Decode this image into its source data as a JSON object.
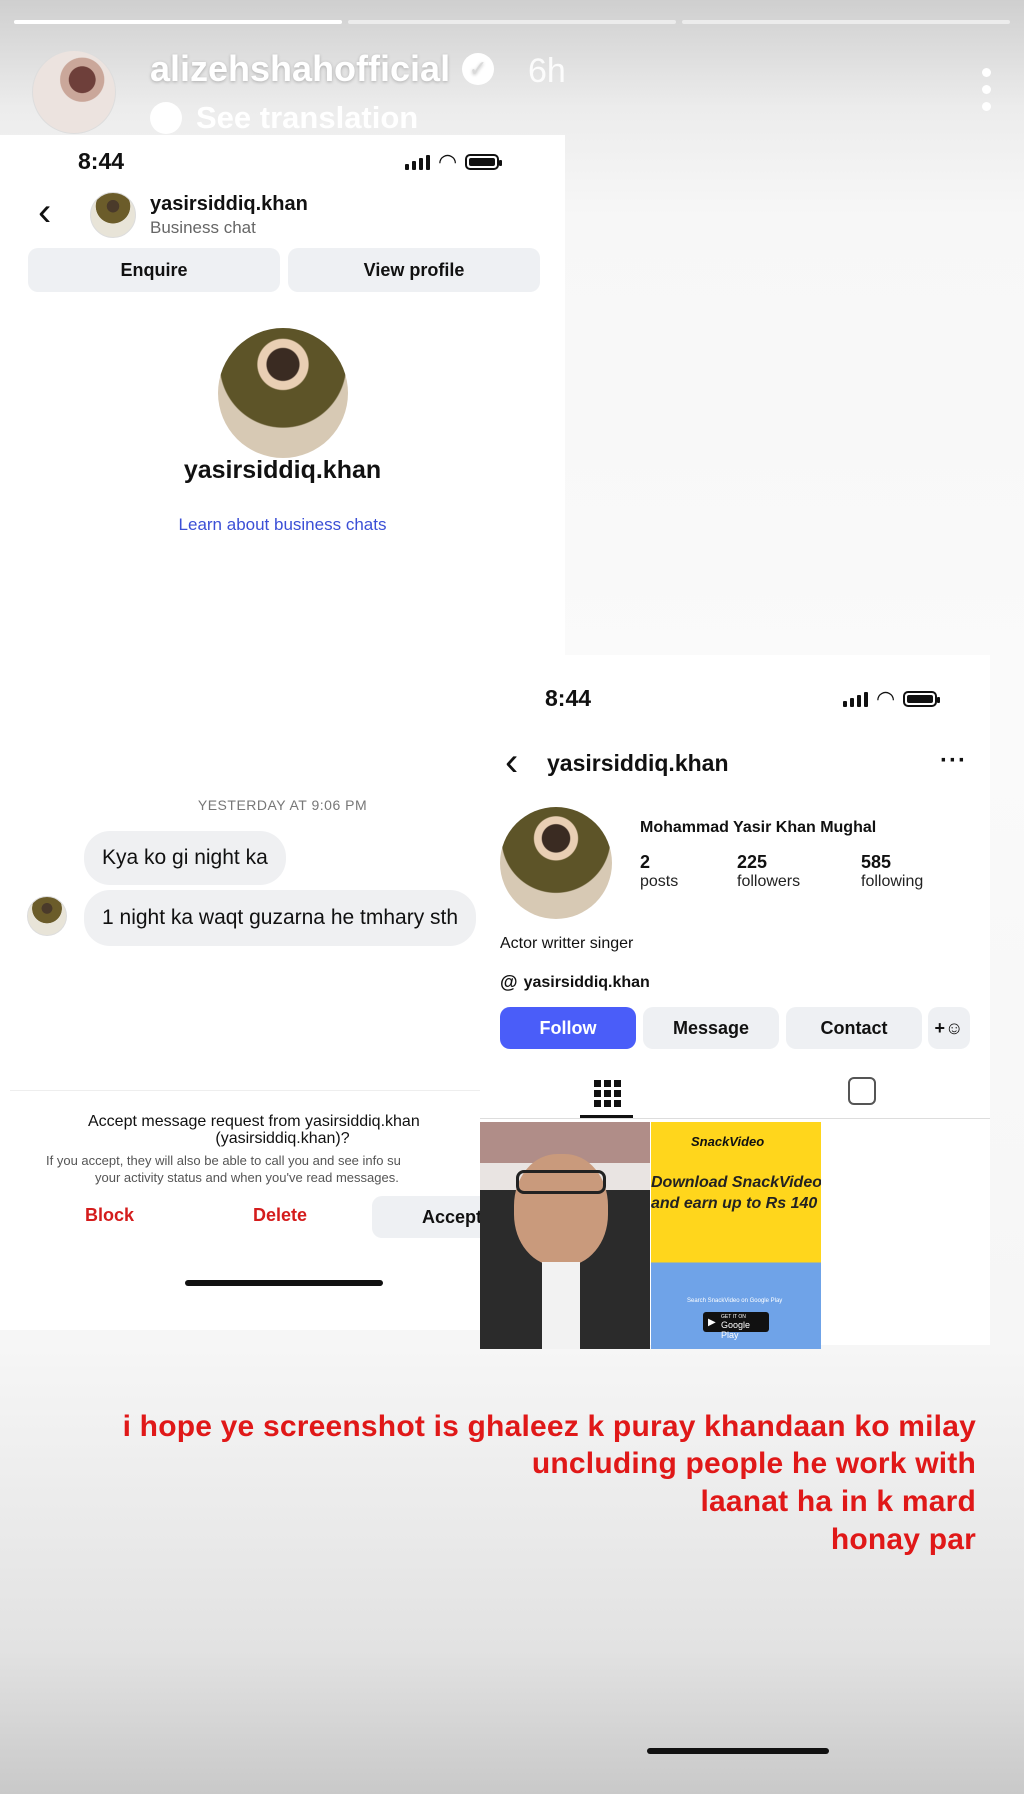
{
  "story": {
    "username": "alizehshahofficial",
    "time_ago": "6h",
    "see_translation": "See translation",
    "progress": [
      1.0,
      0.0,
      0.0
    ]
  },
  "left_screen": {
    "status_time": "8:44",
    "chat_username": "yasirsiddiq.khan",
    "chat_subtitle": "Business chat",
    "enquire_label": "Enquire",
    "view_profile_label": "View profile",
    "profile_name": "yasirsiddiq.khan",
    "learn_link": "Learn about business chats",
    "timestamp": "YESTERDAY AT 9:06 PM",
    "messages": [
      "Kya ko gi night ka",
      "1 night ka waqt guzarna he tmhary sth"
    ],
    "request_title_line1": "Accept message request from yasirsiddiq.khan",
    "request_title_line2": "(yasirsiddiq.khan)?",
    "request_body_line1": "If you accept, they will also be able to call you and see info su",
    "request_body_line2": "your activity status and when you've read messages.",
    "block_label": "Block",
    "delete_label": "Delete",
    "accept_label": "Accept"
  },
  "right_screen": {
    "status_time": "8:44",
    "username": "yasirsiddiq.khan",
    "full_name": "Mohammad Yasir Khan Mughal",
    "posts_count": "2",
    "posts_label": "posts",
    "followers_count": "225",
    "followers_label": "followers",
    "following_count": "585",
    "following_label": "following",
    "bio": "Actor writter singer",
    "threads_handle": "yasirsiddiq.khan",
    "follow_label": "Follow",
    "message_label": "Message",
    "contact_label": "Contact",
    "ad_brand": "SnackVideo",
    "ad_line1": "Download SnackVideo",
    "ad_line2": "and earn up to Rs 140",
    "ad_small": "Search SnackVideo on Google Play",
    "ad_store": "Google Play",
    "ad_store_top": "GET IT ON"
  },
  "overlay": {
    "line1": "i hope ye screenshot is ghaleez k puray khandaan ko milay",
    "line2": "uncluding people  he work with",
    "line3": "laanat ha in  k mard",
    "line4": "honay par"
  },
  "colors": {
    "follow_blue": "#4a5df9",
    "link_blue": "#3b4fd6",
    "danger_red": "#d41c1c",
    "overlay_red": "#e01818"
  }
}
